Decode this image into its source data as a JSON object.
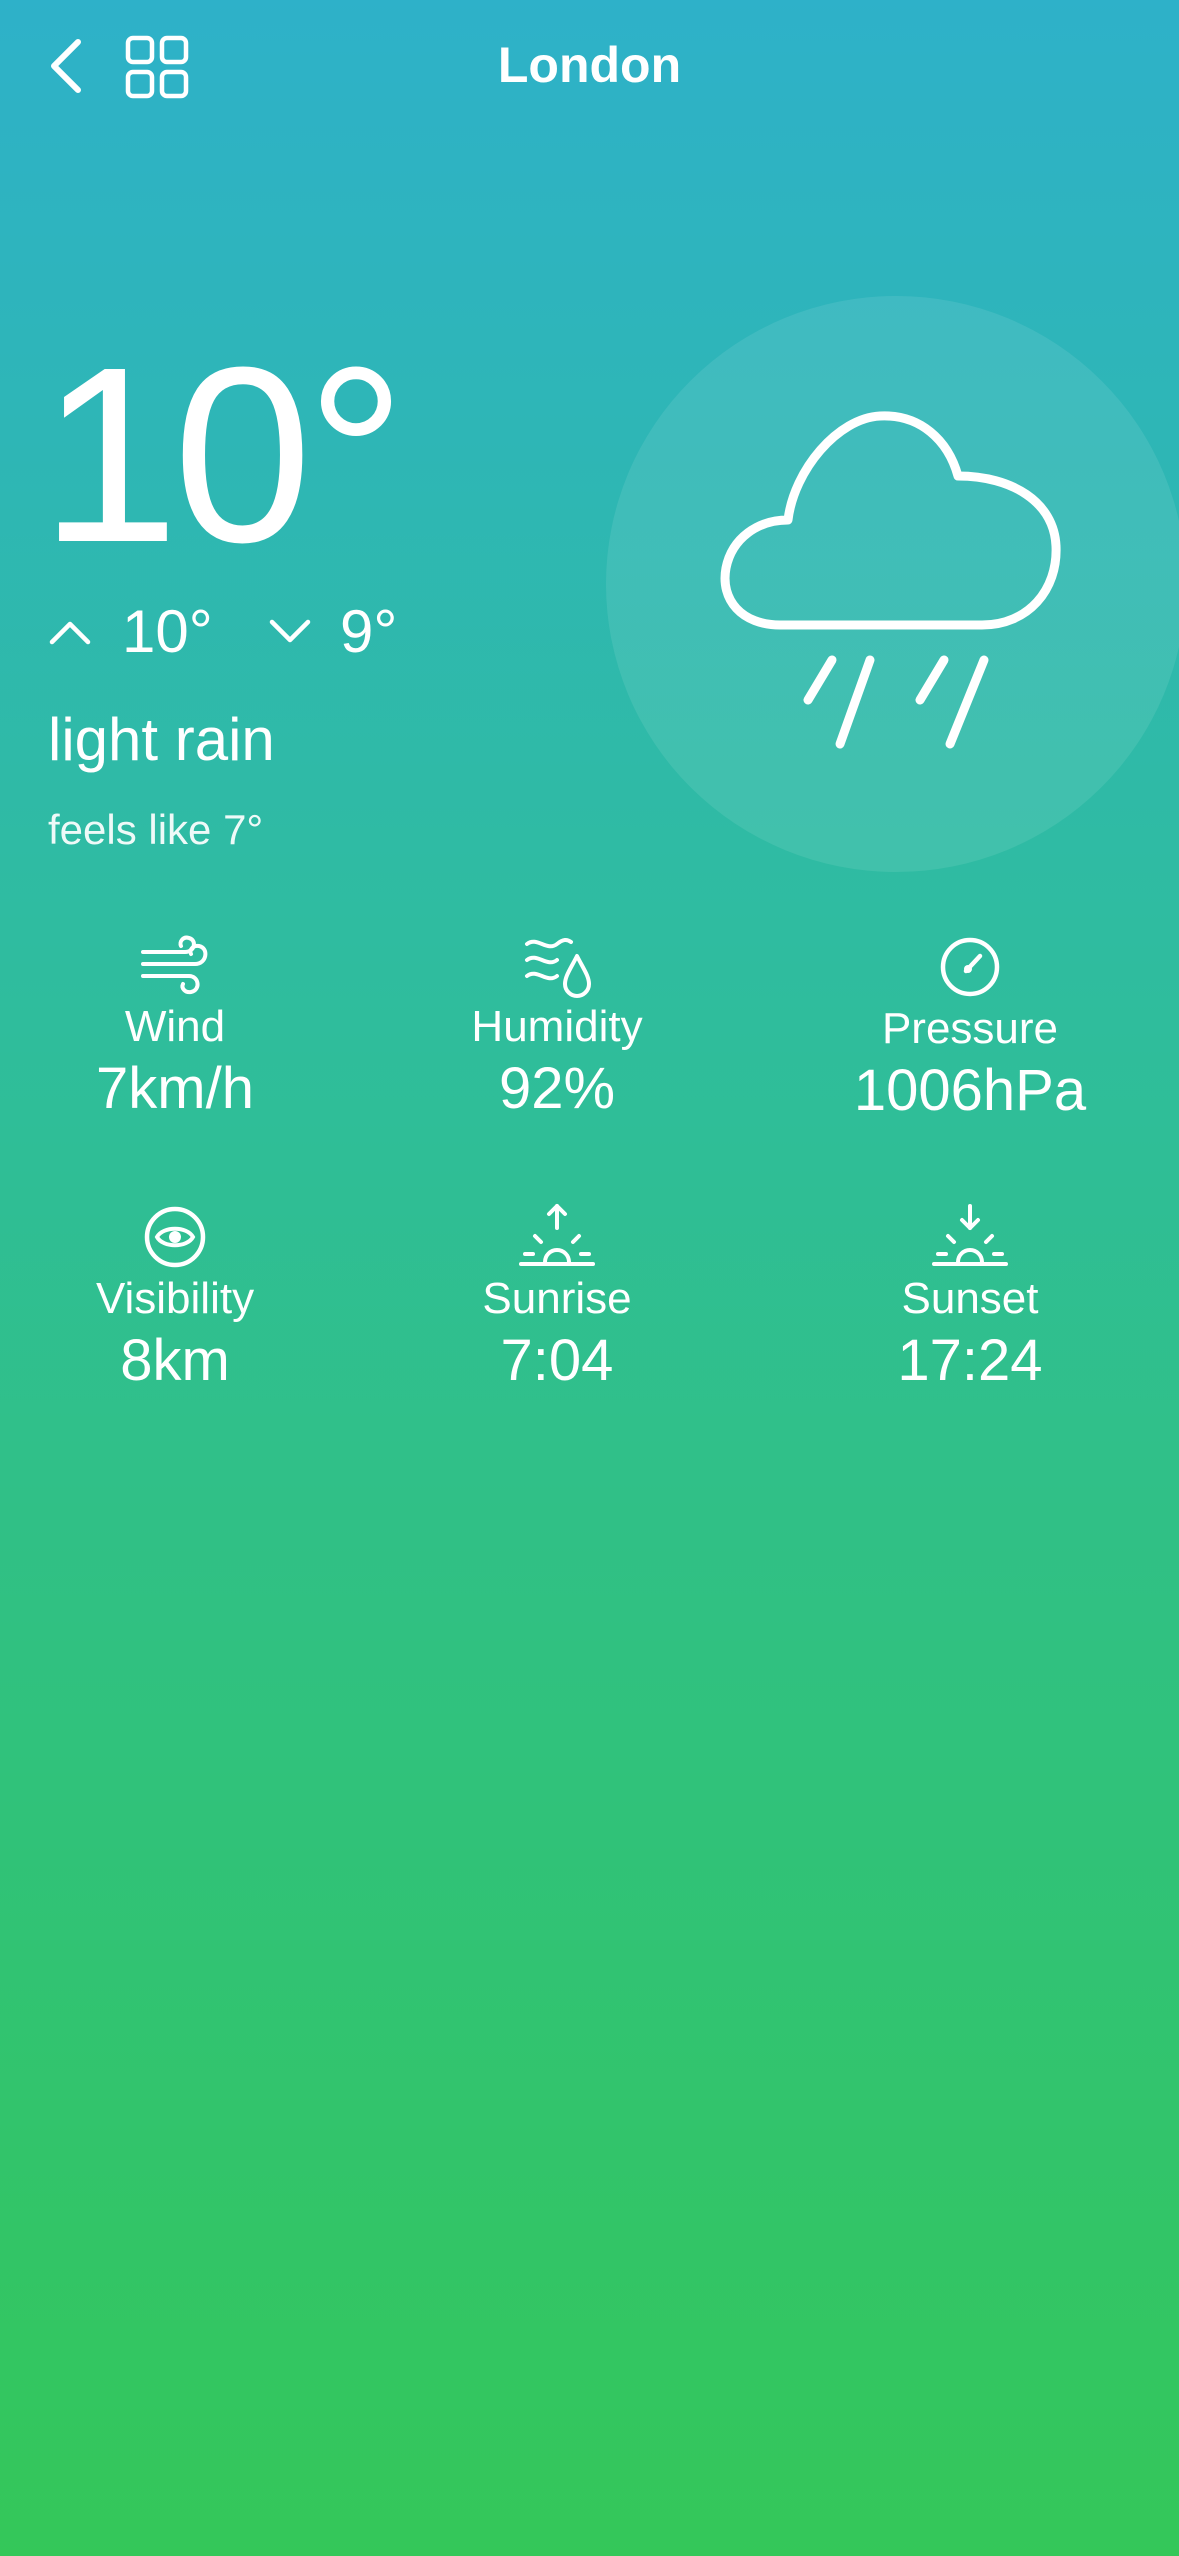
{
  "header": {
    "city": "London",
    "back_icon": "chevron-left-icon",
    "grid_icon": "grid-icon"
  },
  "current": {
    "temperature": "10°",
    "high": "10°",
    "low": "9°",
    "description": "light rain",
    "feels_like": "feels like 7°",
    "condition_icon": "cloud-rain-icon"
  },
  "metrics": [
    {
      "icon": "wind-icon",
      "label": "Wind",
      "value": "7km/h"
    },
    {
      "icon": "humidity-icon",
      "label": "Humidity",
      "value": "92%"
    },
    {
      "icon": "gauge-icon",
      "label": "Pressure",
      "value": "1006hPa"
    },
    {
      "icon": "eye-icon",
      "label": "Visibility",
      "value": "8km"
    },
    {
      "icon": "sunrise-icon",
      "label": "Sunrise",
      "value": "7:04"
    },
    {
      "icon": "sunset-icon",
      "label": "Sunset",
      "value": "17:24"
    }
  ],
  "colors": {
    "gradient_top": "#2eb1c9",
    "gradient_bottom": "#34c759",
    "text": "#ffffff"
  }
}
